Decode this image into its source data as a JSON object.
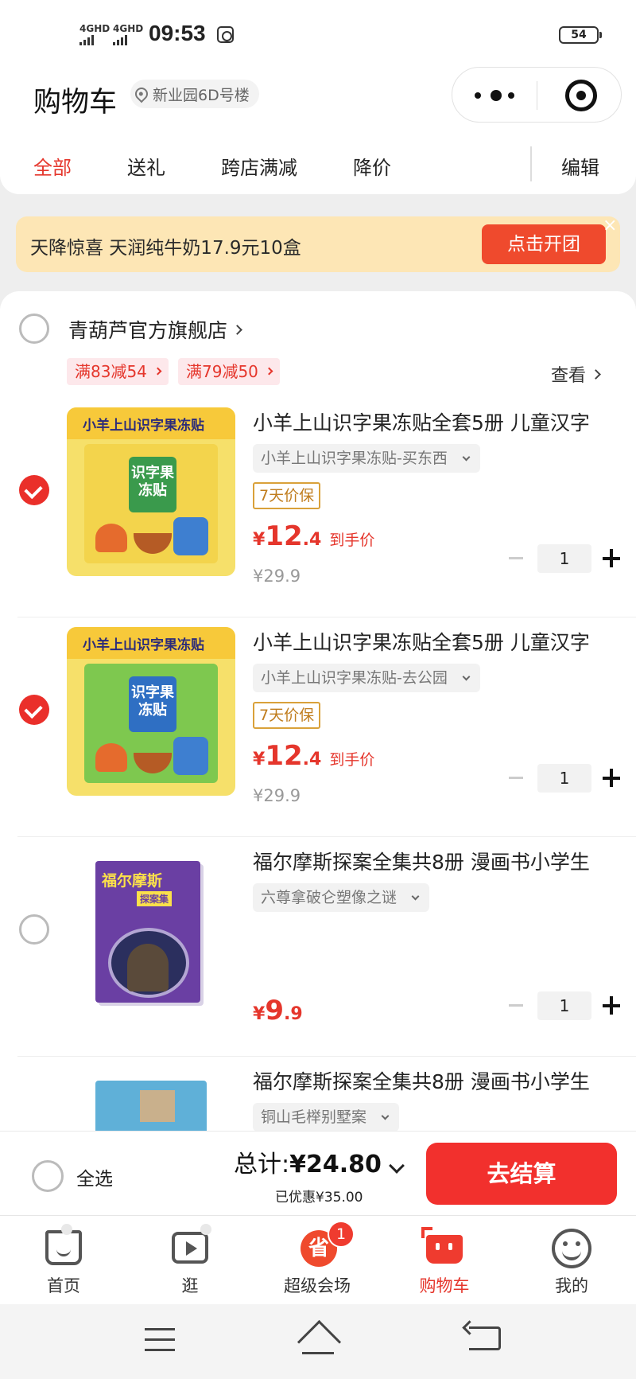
{
  "status_bar": {
    "network_1": "4GHD",
    "network_2": "4GHD",
    "time": "09:53",
    "battery": "54"
  },
  "header": {
    "title": "购物车",
    "location": "新业园6D号楼",
    "capsule_icons": [
      "more-icon",
      "close-miniprogram-icon"
    ]
  },
  "filter_tabs": [
    {
      "label": "全部",
      "active": true
    },
    {
      "label": "送礼",
      "active": false
    },
    {
      "label": "跨店满减",
      "active": false
    },
    {
      "label": "降价",
      "active": false
    }
  ],
  "edit_label": "编辑",
  "banner": {
    "text": "天降惊喜 天润纯牛奶17.9元10盒",
    "button": "点击开团",
    "close": "×"
  },
  "shop": {
    "name": "青葫芦官方旗舰店",
    "coupons": [
      "满83减54",
      "满79减50"
    ],
    "view_label": "查看"
  },
  "items": [
    {
      "checked": true,
      "title": "小羊上山识字果冻贴全套5册 儿童汉字",
      "sku": "小羊上山识字果冻贴-买东西",
      "guarantee": "7天价保",
      "price_currency": "¥",
      "price_int": "12",
      "price_dec": ".4",
      "price_tag": "到手价",
      "original_price": "¥29.9",
      "quantity": "1",
      "cover": {
        "series": "小羊上山识字果冻贴",
        "card": "识字果冻贴"
      }
    },
    {
      "checked": true,
      "title": "小羊上山识字果冻贴全套5册 儿童汉字",
      "sku": "小羊上山识字果冻贴-去公园",
      "guarantee": "7天价保",
      "price_currency": "¥",
      "price_int": "12",
      "price_dec": ".4",
      "price_tag": "到手价",
      "original_price": "¥29.9",
      "quantity": "1",
      "cover": {
        "series": "小羊上山识字果冻贴",
        "card": "识字果冻贴"
      }
    },
    {
      "checked": false,
      "title": "福尔摩斯探案全集共8册 漫画书小学生",
      "sku": "六尊拿破仑塑像之谜",
      "price_currency": "¥",
      "price_int": "9",
      "price_dec": ".9",
      "quantity": "1",
      "cover": {
        "title": "福尔摩斯",
        "sub": "探案集"
      }
    },
    {
      "checked": false,
      "title": "福尔摩斯探案全集共8册 漫画书小学生",
      "sku": "铜山毛榉别墅案"
    }
  ],
  "checkout": {
    "select_all": "全选",
    "total_label": "总计:",
    "total_value": "¥24.80",
    "saved": "已优惠¥35.00",
    "pay_button": "去结算"
  },
  "tabbar": [
    {
      "label": "首页",
      "icon": "home-icon"
    },
    {
      "label": "逛",
      "icon": "play-icon"
    },
    {
      "label": "超级会场",
      "icon": "super-venue-icon",
      "badge": "1",
      "glyph": "省"
    },
    {
      "label": "购物车",
      "icon": "cart-icon",
      "active": true
    },
    {
      "label": "我的",
      "icon": "me-icon"
    }
  ],
  "colors": {
    "accent": "#e5362c",
    "banner_bg": "#fde6b5",
    "pay_button": "#f2302d"
  }
}
